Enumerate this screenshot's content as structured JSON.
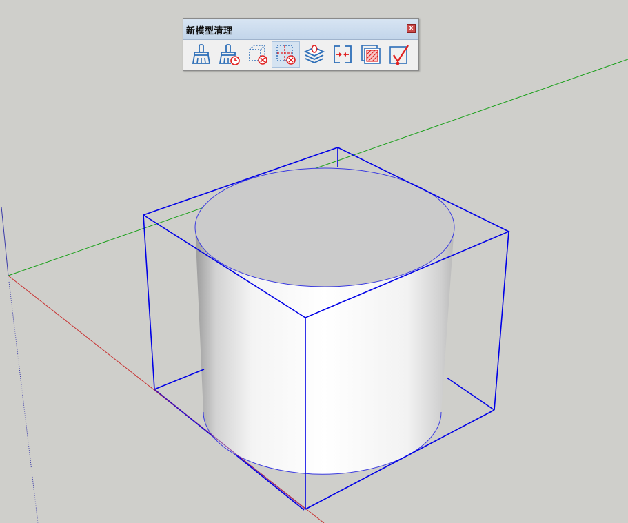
{
  "toolbar": {
    "title": "新模型清理",
    "close_label": "x",
    "tools": [
      {
        "icon": "broom-icon",
        "active": false
      },
      {
        "icon": "broom-clock-icon",
        "active": false
      },
      {
        "icon": "delete-hidden-box-icon",
        "active": false
      },
      {
        "icon": "delete-guides-icon",
        "active": true
      },
      {
        "icon": "layer-zero-icon",
        "active": false
      },
      {
        "icon": "merge-arrows-icon",
        "active": false
      },
      {
        "icon": "hatched-face-icon",
        "active": false
      },
      {
        "icon": "checkmark-icon",
        "active": false
      }
    ]
  },
  "colors": {
    "background": "#cfcfcb",
    "selection": "#0000e6",
    "axis_green": "#1aa01a",
    "axis_red": "#c83232",
    "axis_blue": "#3a3aa8",
    "icon_blue": "#2e6fb8",
    "icon_red": "#e02020"
  }
}
